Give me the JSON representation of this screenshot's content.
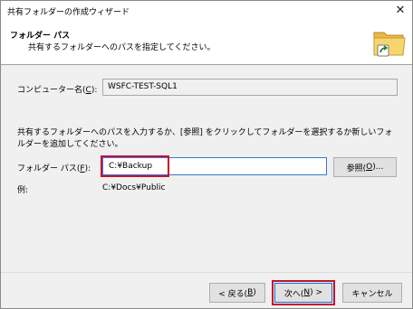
{
  "window": {
    "title": "共有フォルダーの作成ウィザード",
    "close_glyph": "✕"
  },
  "header": {
    "title": "フォルダー パス",
    "subtitle": "共有するフォルダーへのパスを指定してください。"
  },
  "computer": {
    "label_prefix": "コンピューター名(",
    "label_key": "C",
    "label_suffix": "):",
    "value": "WSFC-TEST-SQL1"
  },
  "instructions": "共有するフォルダーへのパスを入力するか、[参照] をクリックしてフォルダーを選択するか新しいフォルダーを追加してください。",
  "folder_path": {
    "label_prefix": "フォルダー パス(",
    "label_key": "F",
    "label_suffix": "):",
    "value": "C:¥Backup"
  },
  "browse_button": {
    "prefix": "参照(",
    "key": "O",
    "suffix": ")..."
  },
  "example": {
    "label": "例:",
    "value": "C:¥Docs¥Public"
  },
  "footer": {
    "back": {
      "prefix": "< 戻る(",
      "key": "B",
      "suffix": ")"
    },
    "next": {
      "prefix": "次へ(",
      "key": "N",
      "suffix": ") >"
    },
    "cancel": "キャンセル"
  },
  "colors": {
    "highlight": "#c8102e",
    "focus": "#0078d7"
  },
  "icons": {
    "header_image": "folder-share-icon"
  }
}
